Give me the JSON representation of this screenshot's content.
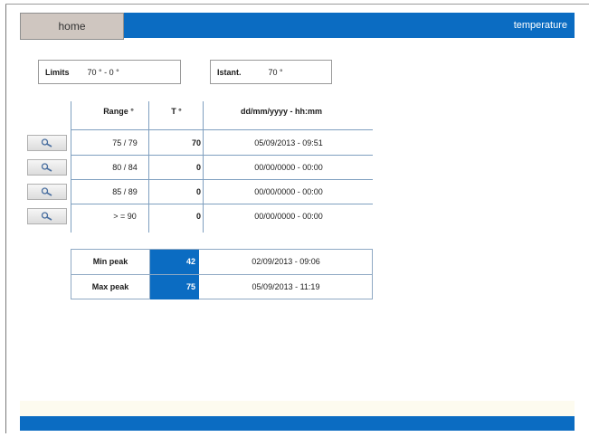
{
  "header": {
    "home_label": "home",
    "title": "temperature"
  },
  "limits": {
    "label": "Limits",
    "value": "70 ° - 0 °"
  },
  "istant": {
    "label": "Istant.",
    "value": "70 °"
  },
  "table": {
    "headers": {
      "range": "Range °",
      "t": "T °",
      "date": "dd/mm/yyyy - hh:mm"
    },
    "rows": [
      {
        "range": "75 / 79",
        "t": "70",
        "date": "05/09/2013 - 09:51"
      },
      {
        "range": "80 / 84",
        "t": "0",
        "date": "00/00/0000 - 00:00"
      },
      {
        "range": "85 / 89",
        "t": "0",
        "date": "00/00/0000 - 00:00"
      },
      {
        "range": "> = 90",
        "t": "0",
        "date": "00/00/0000 - 00:00"
      }
    ]
  },
  "peaks": {
    "min": {
      "label": "Min peak",
      "value": "42",
      "date": "02/09/2013 - 09:06"
    },
    "max": {
      "label": "Max peak",
      "value": "75",
      "date": "05/09/2013 - 11:19"
    }
  },
  "icons": {
    "row_button": "magnifier-icon"
  },
  "colors": {
    "accent": "#0b6cc2",
    "home_tab": "#cfc6c0",
    "grid": "#7f9fbf"
  }
}
